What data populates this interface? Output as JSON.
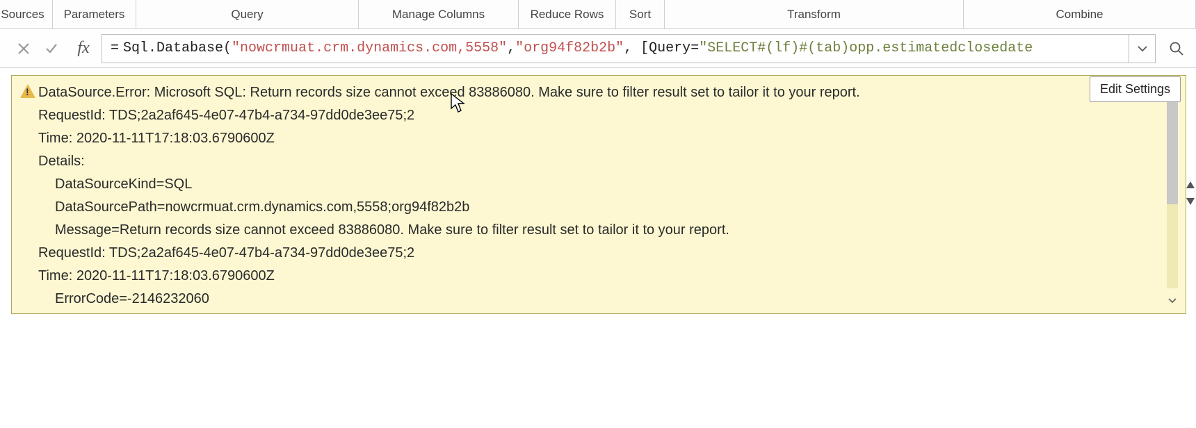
{
  "ribbon": {
    "sources": "Sources",
    "parameters": "Parameters",
    "query": "Query",
    "manage_columns": "Manage Columns",
    "reduce_rows": "Reduce Rows",
    "sort": "Sort",
    "transform": "Transform",
    "combine": "Combine"
  },
  "formula_bar": {
    "cancel_tooltip": "Cancel",
    "confirm_tooltip": "Enter",
    "fx_label": "fx",
    "equals": "=",
    "call": "Sql.Database(",
    "arg1": "\"nowcrmuat.crm.dynamics.com,5558\"",
    "comma1": ", ",
    "arg2": "\"org94f82b2b\"",
    "comma2": ", [Query=",
    "arg3": "\"SELECT#(lf)#(tab)opp.estimatedclosedate",
    "expand_tooltip": "Expand"
  },
  "error": {
    "line1": "DataSource.Error: Microsoft SQL: Return records size cannot exceed 83886080. Make sure to filter result set to tailor it to your report.",
    "line2": "RequestId: TDS;2a2af645-4e07-47b4-a734-97dd0de3ee75;2",
    "line3": "Time: 2020-11-11T17:18:03.6790600Z",
    "line4": "Details:",
    "line5": "DataSourceKind=SQL",
    "line6": "DataSourcePath=nowcrmuat.crm.dynamics.com,5558;org94f82b2b",
    "line7": "Message=Return records size cannot exceed 83886080. Make sure to filter result set to tailor it to your report.",
    "line8": "RequestId: TDS;2a2af645-4e07-47b4-a734-97dd0de3ee75;2",
    "line9": "Time: 2020-11-11T17:18:03.6790600Z",
    "line10": "ErrorCode=-2146232060",
    "edit_settings": "Edit Settings"
  }
}
